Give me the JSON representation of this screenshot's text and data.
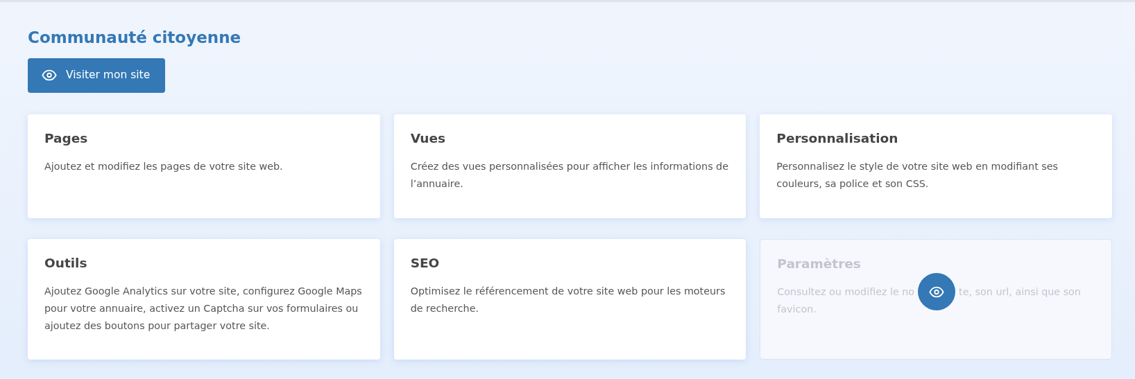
{
  "heading": "Communauté citoyenne",
  "visit_button": {
    "label": "Visiter mon site"
  },
  "cards": [
    {
      "title": "Pages",
      "description": [
        "Ajoutez et modifiez les pages de votre site web."
      ],
      "hovered": false
    },
    {
      "title": "Vues",
      "description": [
        "Créez des vues personnalisées pour afficher les informations de l’annuaire."
      ],
      "hovered": false
    },
    {
      "title": "Personnalisation",
      "description": [
        "Personnalisez le style de votre site web en modifiant ses couleurs, sa police et son CSS."
      ],
      "hovered": false
    },
    {
      "title": "Outils",
      "description": [
        "Ajoutez Google Analytics sur votre site, configurez Google Maps pour votre annuaire, activez un Captcha sur vos formulaires ou ajoutez des boutons pour partager votre site."
      ],
      "hovered": false
    },
    {
      "title": "SEO",
      "description": [
        "Optimisez le référencement de votre site web pour les moteurs de recherche."
      ],
      "hovered": false
    },
    {
      "title": "Paramètres",
      "description": [
        "Consultez ou modifiez le no",
        "te, son url, ainsi que son",
        "favicon."
      ],
      "hovered": true
    }
  ]
}
